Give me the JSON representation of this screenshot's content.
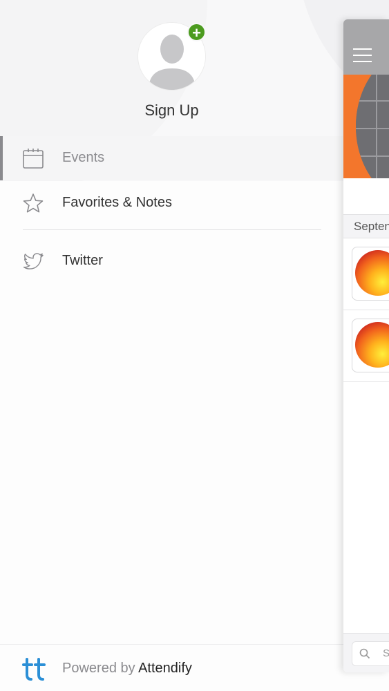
{
  "profile": {
    "signup_label": "Sign Up",
    "add_badge": "+"
  },
  "menu": {
    "items": [
      {
        "label": "Events",
        "icon": "calendar-icon",
        "active": true
      },
      {
        "label": "Favorites & Notes",
        "icon": "star-icon",
        "active": false
      },
      {
        "label": "Twitter",
        "icon": "twitter-icon",
        "active": false
      }
    ]
  },
  "footer": {
    "powered_by": "Powered by",
    "brand": "Attendify",
    "logo": "attendify-logo"
  },
  "background_panel": {
    "section_header": "Septen",
    "search_placeholder": "S",
    "menu_icon": "hamburger-icon"
  },
  "colors": {
    "accent_green": "#4c9b1f",
    "banner_orange": "#f3762c",
    "brand_blue": "#2b8fd6",
    "active_bar": "#8a8a8e"
  }
}
